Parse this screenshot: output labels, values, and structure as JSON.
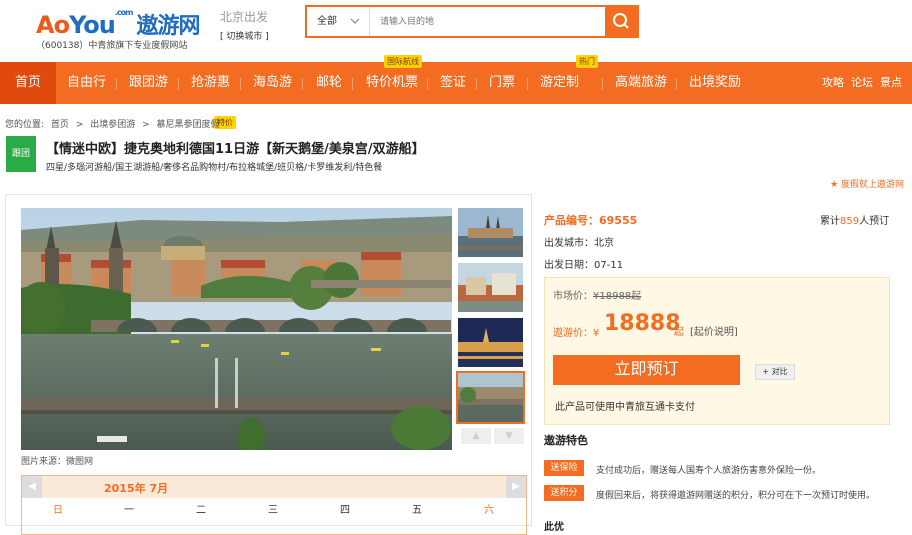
{
  "header": {
    "logo_a": "Ao",
    "logo_b": "You",
    "logo_com": ".com",
    "logo_cn": "遨游网",
    "logo_sub": "（600138）中青旅旗下专业度假网站",
    "city_label": "北京出发",
    "city_switch": "[ 切换城市 ]",
    "search_category": "全部",
    "search_placeholder": "请输入目的地",
    "colors": {
      "accent": "#f36c21",
      "brand_blue": "#1f6cc0"
    }
  },
  "nav": {
    "items": [
      {
        "label": "首页",
        "active": true
      },
      {
        "label": "自由行"
      },
      {
        "label": "跟团游"
      },
      {
        "label": "抢游惠",
        "tag": "特价"
      },
      {
        "label": "海岛游"
      },
      {
        "label": "邮轮"
      },
      {
        "label": "特价机票",
        "tag": "国际航线"
      },
      {
        "label": "签证"
      },
      {
        "label": "门票"
      },
      {
        "label": "游定制",
        "tag": "热门"
      },
      {
        "label": "高端旅游"
      },
      {
        "label": "出境奖励"
      }
    ],
    "right": [
      "攻略",
      "论坛",
      "景点"
    ]
  },
  "breadcrumb": [
    "您的位置:",
    "首页",
    ">",
    "出境参团游",
    ">",
    "慕尼黑参团度假"
  ],
  "product": {
    "badge": "跟团",
    "title": "【情迷中欧】捷克奥地利德国11日游【新天鹅堡/美泉宫/双游船】",
    "tags": "四星/多瑙河游船/国王湖游船/奢侈名品购物村/布拉格城堡/班贝格/卡罗维发利/特色餐",
    "favorite": "★ 度假就上遨游网",
    "image_credit": "图片来源：微图网",
    "code_label": "产品编号：",
    "code": "69555",
    "booked_prefix": "累计",
    "booked_count": "859",
    "booked_suffix": "人预订",
    "departure_city_label": "出发城市：",
    "departure_city": "北京",
    "departure_date_label": "出发日期：",
    "departure_date": "07-11",
    "market_label": "市场价：",
    "market_price": "¥18988起",
    "aoyou_label": "遨游价：¥",
    "aoyou_price": "18888",
    "price_qi": "起",
    "price_note": "[起价说明]",
    "book_button": "立即预订",
    "compare_button": "+ 对比",
    "card_note": "此产品可使用中青旅互通卡支付"
  },
  "calendar": {
    "month": "2015年 7月",
    "prev": "◀",
    "next": "▶",
    "weekdays": [
      "日",
      "一",
      "二",
      "三",
      "四",
      "五",
      "六"
    ]
  },
  "features": {
    "heading": "遨游特色",
    "items": [
      {
        "tag": "送保险",
        "text": "支付成功后，赠送每人国寿个人旅游伤害意外保险一份。"
      },
      {
        "tag": "送积分",
        "text": "度假回来后，将获得遨游网赠送的积分，积分可在下一次预订时使用。"
      }
    ],
    "next_heading": "此优"
  },
  "icons": [
    "search-icon",
    "chevron-down-icon",
    "star-icon",
    "arrow-up-icon",
    "arrow-down-icon",
    "arrow-left-icon",
    "arrow-right-icon"
  ]
}
